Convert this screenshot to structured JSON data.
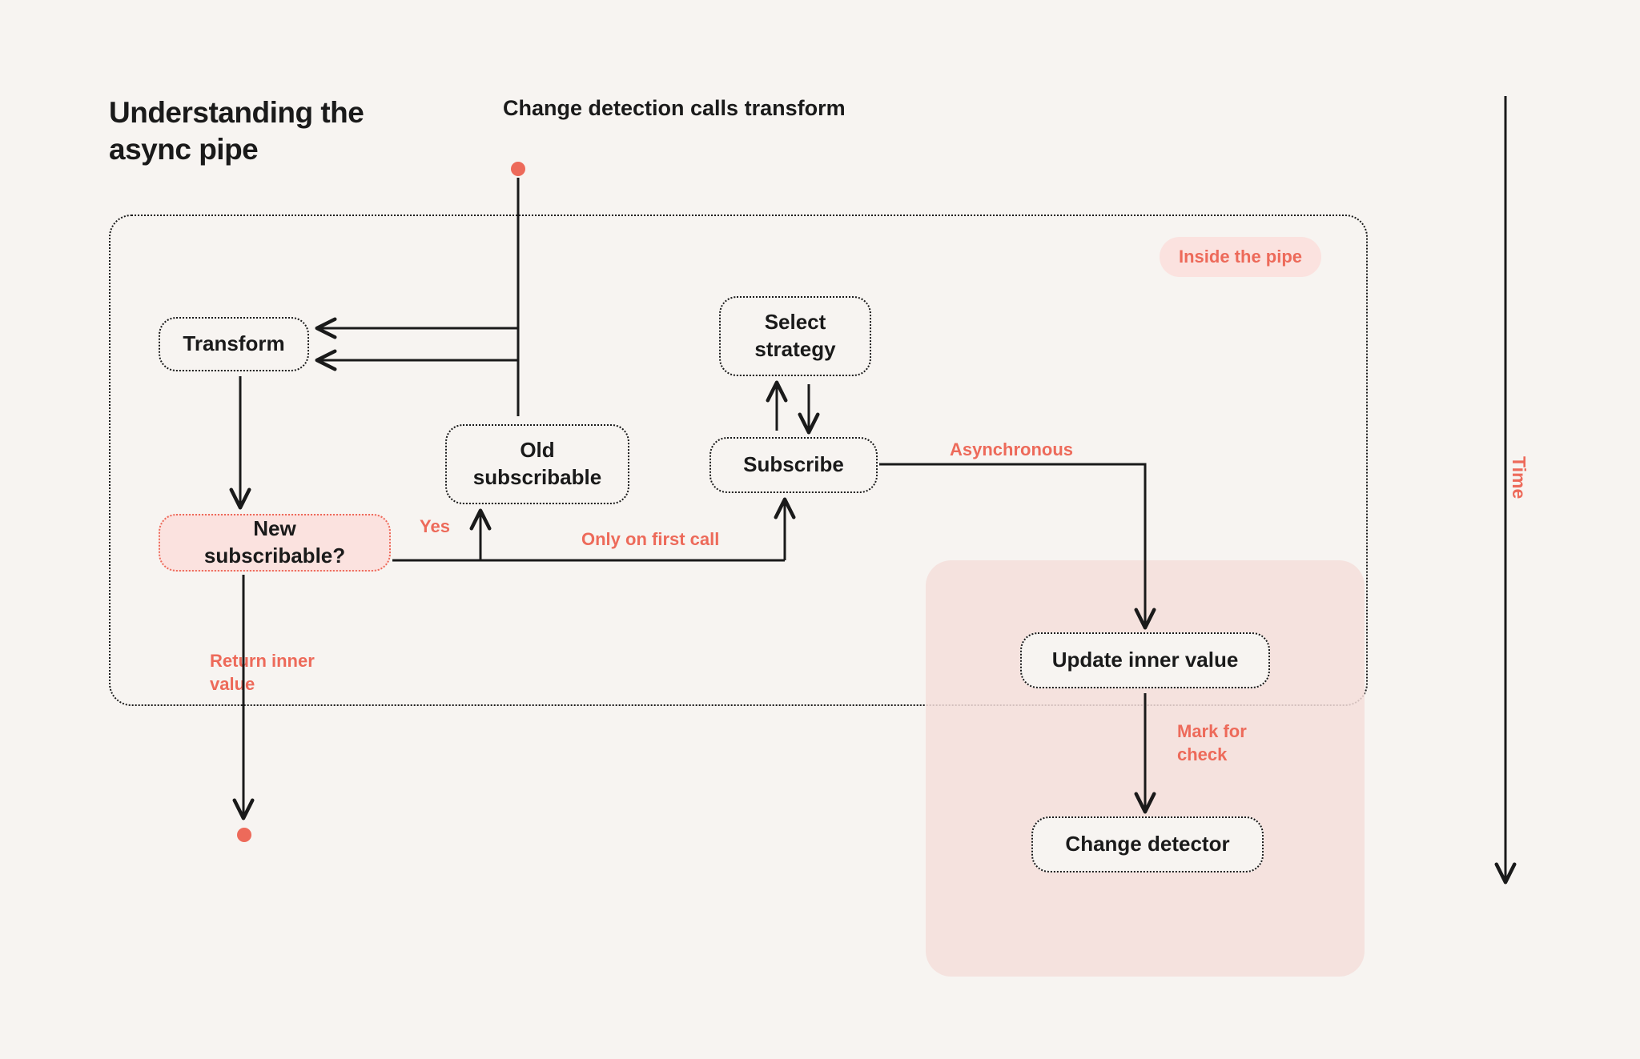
{
  "title": "Understanding the async pipe",
  "start_label": "Change detection calls transform",
  "pipe_badge": "Inside the pipe",
  "time_label": "Time",
  "nodes": {
    "transform": "Transform",
    "new_subscribable": "New subscribable?",
    "old_subscribable": "Old subscribable",
    "select_strategy": "Select strategy",
    "subscribe": "Subscribe",
    "update_inner_value": "Update inner value",
    "change_detector": "Change detector"
  },
  "annotations": {
    "yes": "Yes",
    "only_first": "Only on first call",
    "return_inner": "Return inner value",
    "asynchronous": "Asynchronous",
    "mark_for_check": "Mark for check"
  },
  "colors": {
    "accent": "#ed6a5a",
    "accent_bg": "#fbe2df",
    "page_bg": "#f7f4f1",
    "ink": "#1a1a1a"
  }
}
